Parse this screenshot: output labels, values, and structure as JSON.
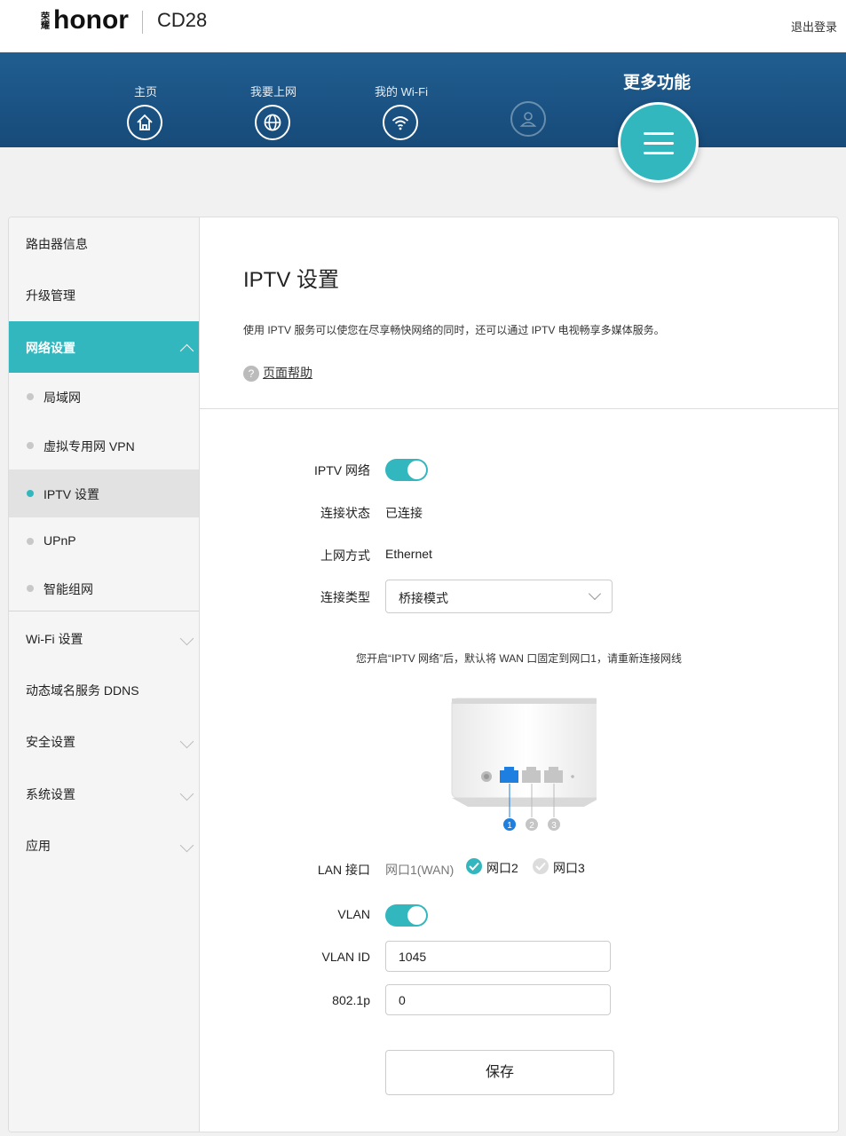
{
  "header": {
    "brand_small": "荣耀",
    "brand": "honor",
    "model": "CD28",
    "logout": "退出登录"
  },
  "nav": {
    "items": [
      {
        "label": "主页",
        "icon": "home-icon"
      },
      {
        "label": "我要上网",
        "icon": "globe-icon"
      },
      {
        "label": "我的 Wi-Fi",
        "icon": "wifi-icon"
      },
      {
        "label": "",
        "icon": "user-icon"
      }
    ],
    "more": {
      "label": "更多功能",
      "icon": "menu-icon"
    }
  },
  "sidebar": {
    "items": [
      {
        "label": "路由器信息"
      },
      {
        "label": "升级管理"
      },
      {
        "label": "网络设置",
        "active": true
      },
      {
        "label": "Wi-Fi 设置"
      },
      {
        "label": "动态域名服务 DDNS"
      },
      {
        "label": "安全设置"
      },
      {
        "label": "系统设置"
      },
      {
        "label": "应用"
      }
    ],
    "subitems": [
      {
        "label": "局域网"
      },
      {
        "label": "虚拟专用网 VPN"
      },
      {
        "label": "IPTV 设置",
        "selected": true
      },
      {
        "label": "UPnP"
      },
      {
        "label": "智能组网"
      }
    ]
  },
  "page": {
    "title": "IPTV 设置",
    "description": "使用 IPTV 服务可以使您在尽享畅快网络的同时，还可以通过 IPTV 电视畅享多媒体服务。",
    "help": "页面帮助",
    "help_icon": "?"
  },
  "form": {
    "iptv_label": "IPTV 网络",
    "iptv_enabled": true,
    "status_label": "连接状态",
    "status_value": "已连接",
    "mode_label": "上网方式",
    "mode_value": "Ethernet",
    "type_label": "连接类型",
    "type_value": "桥接模式",
    "notice": "您开启“IPTV 网络”后，默认将 WAN 口固定到网口1，请重新连接网线",
    "ports": [
      "1",
      "2",
      "3"
    ],
    "lan_label": "LAN 接口",
    "lan_wan": "网口1(WAN)",
    "lan_port2": "网口2",
    "lan_port2_checked": true,
    "lan_port3": "网口3",
    "lan_port3_checked": false,
    "vlan_label": "VLAN",
    "vlan_enabled": true,
    "vlan_id_label": "VLAN ID",
    "vlan_id_value": "1045",
    "p8021_label": "802.1p",
    "p8021_value": "0",
    "save": "保存"
  },
  "colors": {
    "accent": "#33b7be",
    "nav_blue": "#1a5283",
    "port_active": "#1e7fe0"
  }
}
